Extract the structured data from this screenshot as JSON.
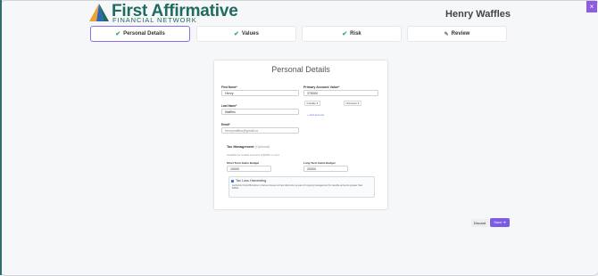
{
  "brand": {
    "title": "First Affirmative",
    "subtitle": "FINANCIAL NETWORK",
    "colors": {
      "primary": "#1f6b60",
      "accent_orange": "#f0a23a",
      "accent_blue": "#2e66b5"
    }
  },
  "window": {
    "close_label": "×"
  },
  "user": {
    "name": "Henry Waffles"
  },
  "steps": [
    {
      "label": "Personal Details",
      "state": "active",
      "icon": "check-icon"
    },
    {
      "label": "Values",
      "state": "complete",
      "icon": "check-icon"
    },
    {
      "label": "Risk",
      "state": "complete",
      "icon": "check-icon"
    },
    {
      "label": "Review",
      "state": "pending",
      "icon": "pencil-icon"
    }
  ],
  "form": {
    "title": "Personal Details",
    "first_name": {
      "label": "First Name*",
      "value": "Henry"
    },
    "last_name": {
      "label": "Last Name*",
      "value": "Waffles"
    },
    "email": {
      "label": "Email*",
      "value": "henrywaffles@gmail.co"
    },
    "primary_account_value": {
      "label": "Primary Account Value*",
      "value": "375000"
    },
    "account_type_1": "Outside",
    "account_type_2": "Unknown",
    "add_account_link": "Add account"
  },
  "tax": {
    "title": "Tax Management",
    "optional": "(Optional)",
    "note": "Available for taxable accounts of $250k or more",
    "short_term": {
      "label": "Short Term Gains Budget",
      "value": "10000"
    },
    "long_term": {
      "label": "Long Term Gains Budget",
      "value": "20000"
    },
    "loss_harvesting": {
      "label": "Tax Loss Harvesting",
      "checked": true,
      "description": "Authorize First Affirmative to harvest losses at their discretion as part of ongoing management for taxable accounts greater than $250k."
    }
  },
  "actions": {
    "discard": "Discard",
    "save": "Save"
  }
}
